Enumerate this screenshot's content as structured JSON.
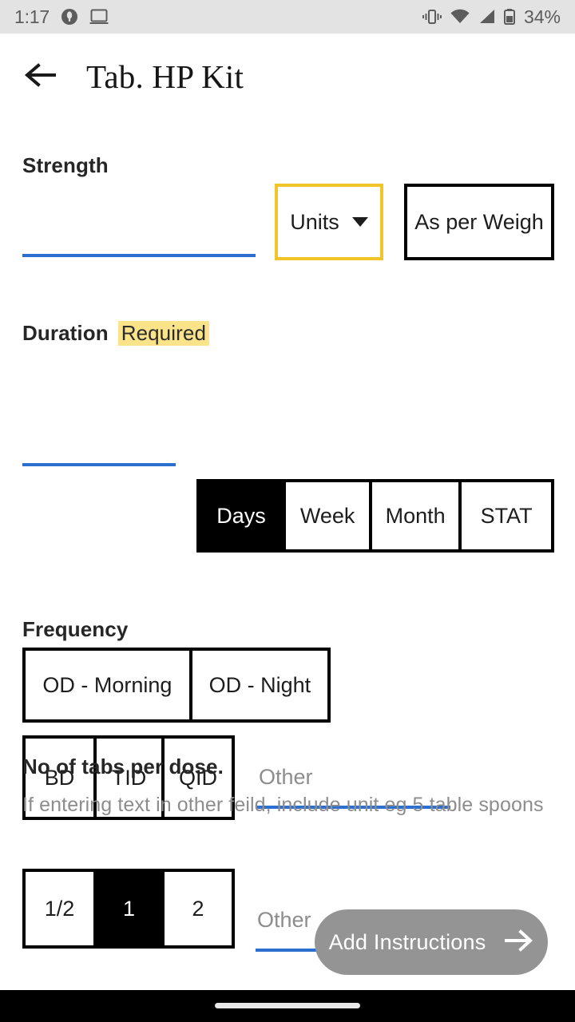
{
  "status_bar": {
    "time": "1:17",
    "battery_percent": "34%",
    "icons": [
      "notification-dot-icon",
      "cast-screen-icon",
      "vibrate-icon",
      "wifi-icon",
      "cellular-signal-icon",
      "battery-icon"
    ]
  },
  "app_bar": {
    "back_icon": "back-arrow-icon",
    "title": "Tab. HP Kit"
  },
  "strength": {
    "label": "Strength",
    "input_value": "",
    "input_placeholder": "",
    "units_button": "Units",
    "units_caret": "chevron-down-icon",
    "as_per_weight_button": "As per Weigh"
  },
  "duration": {
    "label": "Duration",
    "required_badge": "Required",
    "input_value": "",
    "input_placeholder": "",
    "options": [
      {
        "label": "Days",
        "selected": true
      },
      {
        "label": "Week",
        "selected": false
      },
      {
        "label": "Month",
        "selected": false
      },
      {
        "label": "STAT",
        "selected": false
      }
    ]
  },
  "frequency": {
    "label": "Frequency",
    "row1": [
      {
        "label": "OD - Morning",
        "selected": false
      },
      {
        "label": "OD - Night",
        "selected": false
      }
    ],
    "row2": [
      {
        "label": "BD",
        "selected": false
      },
      {
        "label": "TID",
        "selected": false
      },
      {
        "label": "QID",
        "selected": false
      }
    ],
    "other_placeholder": "Other",
    "other_value": ""
  },
  "tabs_per_dose": {
    "label": "No of tabs per dose.",
    "helper": "If entering text in other feild, include unit eg 5 table spoons",
    "options": [
      {
        "label": "1/2",
        "selected": false
      },
      {
        "label": "1",
        "selected": true
      },
      {
        "label": "2",
        "selected": false
      }
    ],
    "other_placeholder": "Other",
    "other_value": ""
  },
  "fab": {
    "label": "Add Instructions",
    "arrow_icon": "arrow-right-icon"
  },
  "colors": {
    "accent_blue": "#2c6fd1",
    "highlight_yellow": "#fbe38a",
    "units_border_yellow": "#f1c427",
    "selected_black": "#000000",
    "fab_gray": "#949494",
    "status_bar_gray": "#e3e3e3"
  }
}
